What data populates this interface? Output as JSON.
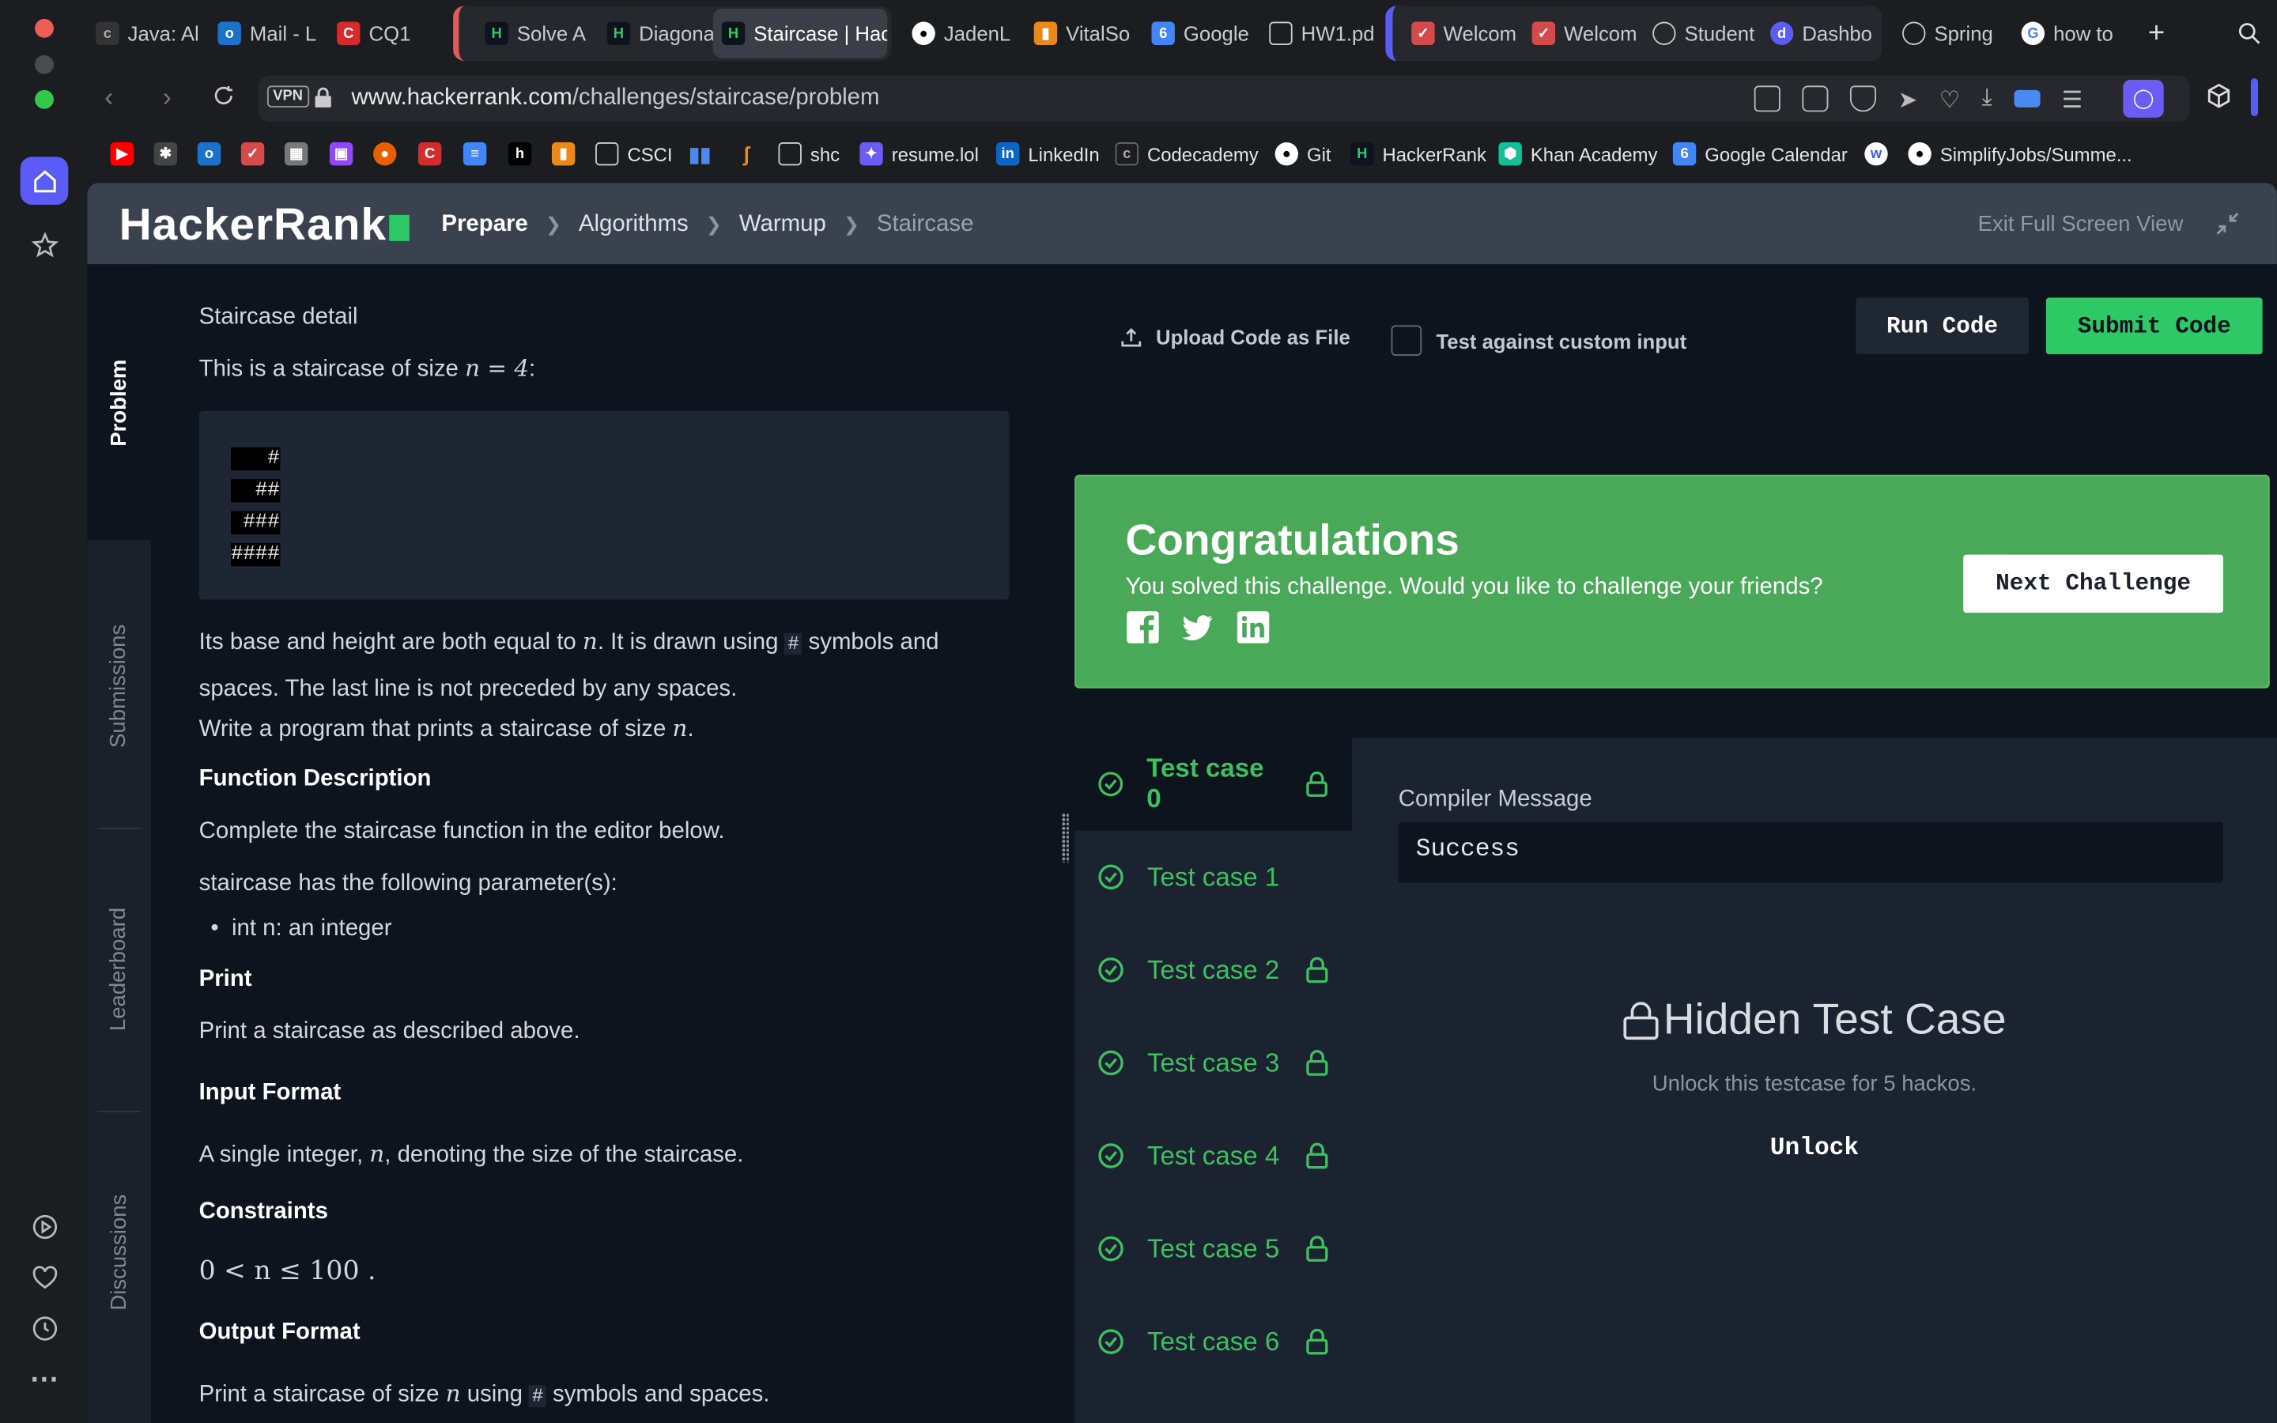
{
  "browser": {
    "tabs": [
      {
        "label": "Java: Al"
      },
      {
        "label": "Mail - L"
      },
      {
        "label": "CQ1"
      },
      {
        "label": "Solve A"
      },
      {
        "label": "Diagona"
      },
      {
        "label": "Staircase | Hac"
      },
      {
        "label": "JadenL"
      },
      {
        "label": "VitalSo"
      },
      {
        "label": "Google"
      },
      {
        "label": "HW1.pd"
      },
      {
        "label": "Welcom"
      },
      {
        "label": "Welcom"
      },
      {
        "label": "Student"
      },
      {
        "label": "Dashbo"
      },
      {
        "label": "Spring"
      },
      {
        "label": "how to"
      }
    ],
    "url_domain": "www.hackerrank.com",
    "url_path": "/challenges/staircase/problem",
    "vpn_label": "VPN",
    "bookmarks": [
      "CSCI",
      "shc",
      "resume.lol",
      "LinkedIn",
      "Codecademy",
      "Git",
      "HackerRank",
      "Khan Academy",
      "Google Calendar",
      "SimplifyJobs/Summe..."
    ]
  },
  "header": {
    "logo": "HackerRank",
    "breadcrumbs": [
      "Prepare",
      "Algorithms",
      "Warmup",
      "Staircase"
    ],
    "exit_fullscreen": "Exit Full Screen View"
  },
  "side_tabs": [
    "Problem",
    "Submissions",
    "Leaderboard",
    "Discussions"
  ],
  "problem": {
    "detail_title": "Staircase detail",
    "intro": "This is a staircase of size",
    "intro_math": "n = 4",
    "staircase_lines": [
      "   #",
      "  ##",
      " ###",
      "####"
    ],
    "para1a": "Its base and height are both equal to",
    "para1b": ". It is drawn using",
    "para1c": "symbols and",
    "para1d": "spaces. The last line is not preceded by any spaces.",
    "para2a": "Write a program that prints a staircase of size",
    "func_desc_heading": "Function Description",
    "func_desc": "Complete the staircase function in the editor below.",
    "params_intro": "staircase has the following parameter(s):",
    "param1": "int n: an integer",
    "print_heading": "Print",
    "print_text": "Print a staircase as described above.",
    "input_heading": "Input Format",
    "input_text_a": "A single integer,",
    "input_text_b": ", denoting the size of the staircase.",
    "constraints_heading": "Constraints",
    "constraint": "0 < n ≤ 100 .",
    "output_heading": "Output Format",
    "output_text_a": "Print a staircase of size",
    "output_text_b": "using",
    "output_text_c": "symbols and spaces.",
    "var_n": "n",
    "hash": "#"
  },
  "editor_bar": {
    "upload": "Upload Code as File",
    "custom_input": "Test against custom input",
    "run": "Run Code",
    "submit": "Submit Code"
  },
  "congrats": {
    "title": "Congratulations",
    "subtitle": "You solved this challenge. Would you like to challenge your friends?",
    "next": "Next Challenge"
  },
  "test_cases": [
    {
      "label": "Test case 0",
      "locked": true
    },
    {
      "label": "Test case 1",
      "locked": false
    },
    {
      "label": "Test case 2",
      "locked": true
    },
    {
      "label": "Test case 3",
      "locked": true
    },
    {
      "label": "Test case 4",
      "locked": true
    },
    {
      "label": "Test case 5",
      "locked": true
    },
    {
      "label": "Test case 6",
      "locked": true
    }
  ],
  "result": {
    "compiler_label": "Compiler Message",
    "compiler_message": "Success",
    "hidden_title": "Hidden Test Case",
    "hidden_sub": "Unlock this testcase for 5 hackos.",
    "unlock": "Unlock"
  },
  "colors": {
    "accent": "#2ec866",
    "success_banner": "#4aa859",
    "header": "#39424e",
    "bg": "#0e141e"
  }
}
